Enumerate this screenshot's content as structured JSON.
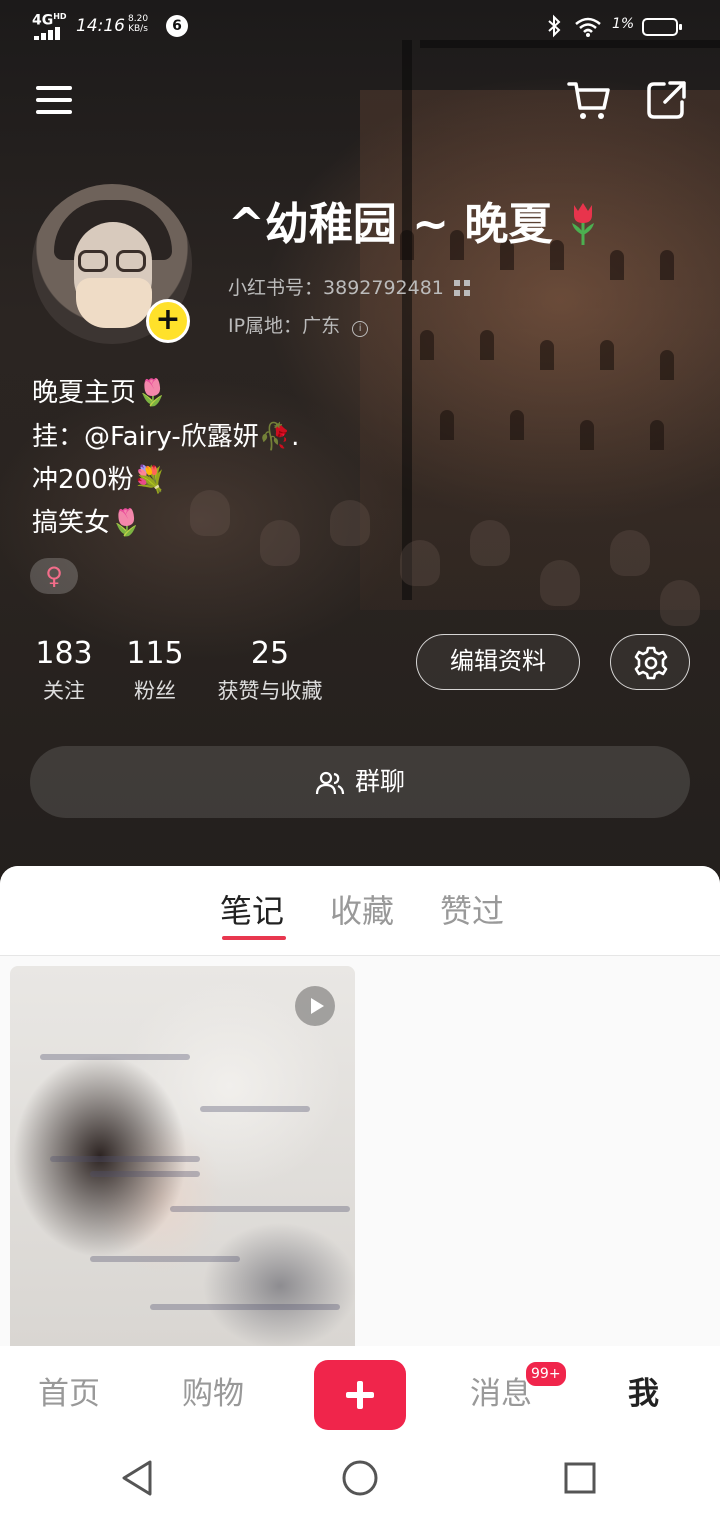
{
  "status_bar": {
    "network": "4G",
    "network_sup": "HD",
    "time": "14:16",
    "speed_value": "8.20",
    "speed_unit": "KB/s",
    "notification_count": "6",
    "battery_percent": "1%"
  },
  "profile": {
    "nickname": "^幼稚园 ~ 晚夏",
    "id_label": "小红书号：",
    "id_value": "3892792481",
    "ip_label": "IP属地：",
    "ip_value": "广东",
    "bio": [
      "晚夏主页🌷",
      "挂：@Fairy-欣露妍🥀.",
      "冲200粉💐",
      "搞笑女🌷"
    ],
    "gender_symbol": "♀"
  },
  "stats": [
    {
      "value": "183",
      "label": "关注"
    },
    {
      "value": "115",
      "label": "粉丝"
    },
    {
      "value": "25",
      "label": "获赞与收藏"
    }
  ],
  "buttons": {
    "edit_profile": "编辑资料",
    "group_chat": "群聊"
  },
  "tabs": [
    {
      "label": "笔记",
      "active": true
    },
    {
      "label": "收藏",
      "active": false
    },
    {
      "label": "赞过",
      "active": false
    }
  ],
  "bottom_nav": {
    "home": "首页",
    "shop": "购物",
    "messages": "消息",
    "messages_badge": "99+",
    "me": "我"
  },
  "colors": {
    "accent_red": "#f0254b",
    "add_yellow": "#ffe12a",
    "tab_underline": "#e8374f"
  },
  "icons": [
    "menu-icon",
    "cart-icon",
    "share-icon",
    "qr-code-icon",
    "info-icon",
    "settings-icon",
    "group-icon",
    "play-icon",
    "plus-icon",
    "back-icon",
    "home-circle-icon",
    "recents-icon"
  ]
}
